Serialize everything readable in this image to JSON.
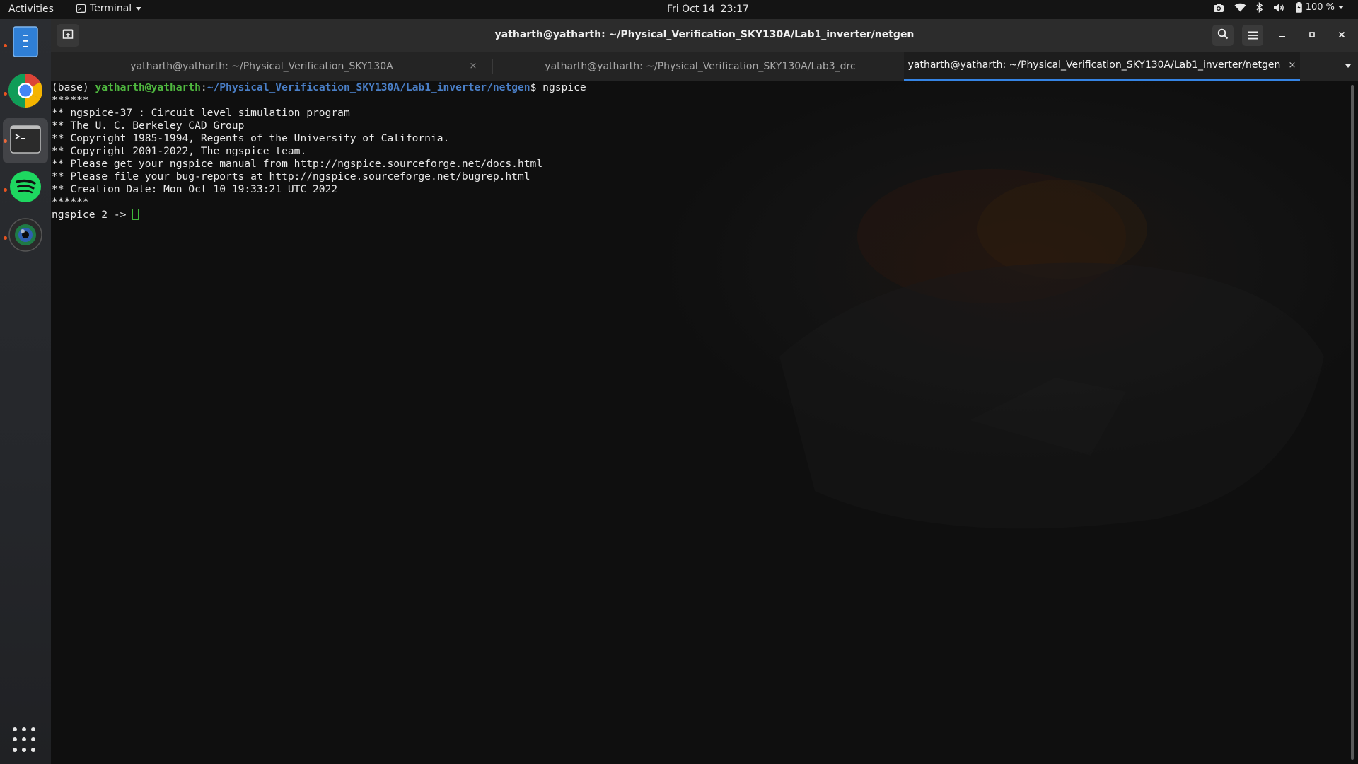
{
  "topbar": {
    "activities": "Activities",
    "app_name": "Terminal",
    "date": "Fri Oct 14",
    "time": "23:17",
    "battery": "100 %"
  },
  "dock": {
    "items": [
      {
        "name": "files",
        "icon": "document-icon",
        "running": true
      },
      {
        "name": "chrome",
        "icon": "chrome-icon",
        "running": true
      },
      {
        "name": "terminal",
        "icon": "terminal-icon",
        "running": true,
        "active": true
      },
      {
        "name": "spotify",
        "icon": "spotify-icon",
        "running": true
      },
      {
        "name": "camera",
        "icon": "camera-lens-icon",
        "running": true
      }
    ]
  },
  "window": {
    "title": "yatharth@yatharth: ~/Physical_Verification_SKY130A/Lab1_inverter/netgen",
    "tabs": [
      {
        "label": "yatharth@yatharth: ~/Physical_Verification_SKY130A",
        "active": false
      },
      {
        "label": "yatharth@yatharth: ~/Physical_Verification_SKY130A/Lab3_drc",
        "active": false
      },
      {
        "label": "yatharth@yatharth: ~/Physical_Verification_SKY130A/Lab1_inverter/netgen",
        "active": true
      }
    ],
    "close_glyph": "×"
  },
  "terminal": {
    "prompt_env": "(base) ",
    "prompt_user": "yatharth@yatharth",
    "prompt_colon": ":",
    "prompt_path": "~/Physical_Verification_SKY130A/Lab1_inverter/netgen",
    "prompt_symbol": "$ ",
    "command": "ngspice",
    "output_lines": [
      "******",
      "** ngspice-37 : Circuit level simulation program",
      "** The U. C. Berkeley CAD Group",
      "** Copyright 1985-1994, Regents of the University of California.",
      "** Copyright 2001-2022, The ngspice team.",
      "** Please get your ngspice manual from http://ngspice.sourceforge.net/docs.html",
      "** Please file your bug-reports at http://ngspice.sourceforge.net/bugrep.html",
      "** Creation Date: Mon Oct 10 19:33:21 UTC 2022",
      "******"
    ],
    "current_prompt": "ngspice 2 -> "
  },
  "colors": {
    "accent": "#3584e4",
    "prompt_user": "#4fb83f",
    "prompt_path": "#4a7fc7",
    "run_indicator": "#e95420"
  }
}
